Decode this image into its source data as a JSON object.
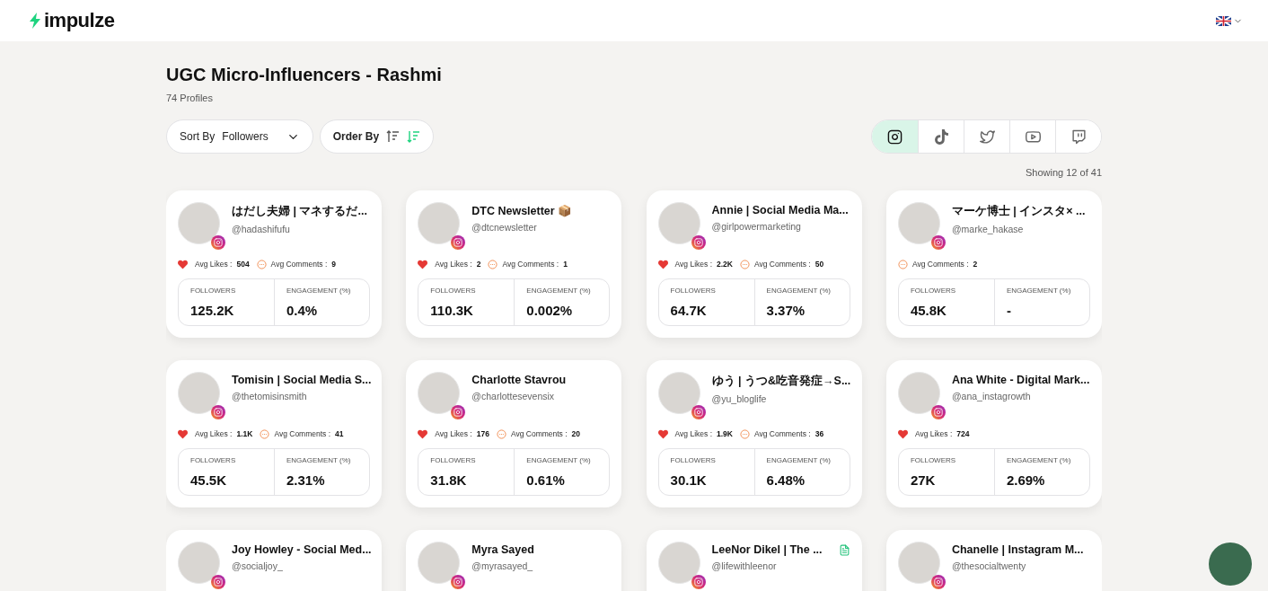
{
  "brand": {
    "name": "impulze"
  },
  "page": {
    "title": "UGC Micro-Influencers - Rashmi",
    "subtitle": "74 Profiles"
  },
  "sort": {
    "label": "Sort By",
    "value": "Followers"
  },
  "order": {
    "label": "Order By",
    "descending": true
  },
  "platforms": [
    {
      "kind": "instagram",
      "selected": true
    },
    {
      "kind": "tiktok",
      "selected": false
    },
    {
      "kind": "twitter",
      "selected": false
    },
    {
      "kind": "youtube",
      "selected": false
    },
    {
      "kind": "twitch",
      "selected": false
    }
  ],
  "showing": "Showing 12 of 41",
  "cards": [
    {
      "name": "はだし夫婦 | マネするだ...",
      "handle": "@hadashifufu",
      "doc": false,
      "likes_label": "Avg Likes :",
      "likes": "504",
      "comments_label": "Avg Comments :",
      "comments": "9",
      "followers_label": "FOLLOWERS",
      "followers": "125.2K",
      "engagement_label": "ENGAGEMENT (%)",
      "engagement": "0.4%"
    },
    {
      "name": "DTC Newsletter 📦",
      "handle": "@dtcnewsletter",
      "doc": false,
      "likes_label": "Avg Likes :",
      "likes": "2",
      "comments_label": "Avg Comments :",
      "comments": "1",
      "followers_label": "FOLLOWERS",
      "followers": "110.3K",
      "engagement_label": "ENGAGEMENT (%)",
      "engagement": "0.002%"
    },
    {
      "name": "Annie | Social Media Ma...",
      "handle": "@girlpowermarketing",
      "doc": false,
      "likes_label": "Avg Likes :",
      "likes": "2.2K",
      "comments_label": "Avg Comments :",
      "comments": "50",
      "followers_label": "FOLLOWERS",
      "followers": "64.7K",
      "engagement_label": "ENGAGEMENT (%)",
      "engagement": "3.37%"
    },
    {
      "name": "マーケ博士 | インスタ× ...",
      "handle": "@marke_hakase",
      "doc": false,
      "comments_label": "Avg Comments :",
      "comments": "2",
      "followers_label": "FOLLOWERS",
      "followers": "45.8K",
      "engagement_label": "ENGAGEMENT (%)",
      "engagement": "-"
    },
    {
      "name": "Tomisin | Social Media S...",
      "handle": "@thetomisinsmith",
      "doc": false,
      "likes_label": "Avg Likes :",
      "likes": "1.1K",
      "comments_label": "Avg Comments :",
      "comments": "41",
      "followers_label": "FOLLOWERS",
      "followers": "45.5K",
      "engagement_label": "ENGAGEMENT (%)",
      "engagement": "2.31%"
    },
    {
      "name": "Charlotte Stavrou",
      "handle": "@charlottesevensix",
      "doc": false,
      "likes_label": "Avg Likes :",
      "likes": "176",
      "comments_label": "Avg Comments :",
      "comments": "20",
      "followers_label": "FOLLOWERS",
      "followers": "31.8K",
      "engagement_label": "ENGAGEMENT (%)",
      "engagement": "0.61%"
    },
    {
      "name": "ゆう | うつ&吃音発症→S...",
      "handle": "@yu_bloglife",
      "doc": false,
      "likes_label": "Avg Likes :",
      "likes": "1.9K",
      "comments_label": "Avg Comments :",
      "comments": "36",
      "followers_label": "FOLLOWERS",
      "followers": "30.1K",
      "engagement_label": "ENGAGEMENT (%)",
      "engagement": "6.48%"
    },
    {
      "name": "Ana White - Digital Mark...",
      "handle": "@ana_instagrowth",
      "doc": false,
      "likes_label": "Avg Likes :",
      "likes": "724",
      "followers_label": "FOLLOWERS",
      "followers": "27K",
      "engagement_label": "ENGAGEMENT (%)",
      "engagement": "2.69%"
    },
    {
      "name": "Joy Howley - Social Med...",
      "handle": "@socialjoy_",
      "doc": false
    },
    {
      "name": "Myra Sayed",
      "handle": "@myrasayed_",
      "doc": false
    },
    {
      "name": "LeeNor Dikel | The ...",
      "handle": "@lifewithleenor",
      "doc": true
    },
    {
      "name": "Chanelle  |  Instagram M...",
      "handle": "@thesocialtwenty",
      "doc": false
    }
  ]
}
